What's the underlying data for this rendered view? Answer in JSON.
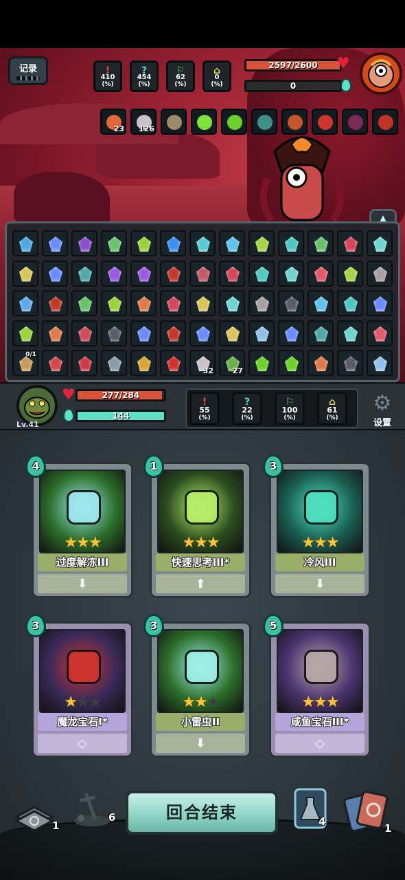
{
  "header": {
    "record_label": "记录"
  },
  "enemy": {
    "stats": [
      {
        "glyph": "!",
        "value": "410",
        "unit": "(%)",
        "color": "#e24a4a"
      },
      {
        "glyph": "?",
        "value": "454",
        "unit": "(%)",
        "color": "#4ad6d0"
      },
      {
        "glyph": "⚐",
        "value": "62",
        "unit": "(%)",
        "color": "#5fdc5a"
      },
      {
        "glyph": "⌂",
        "value": "0",
        "unit": "(%)",
        "color": "#e4d35a"
      }
    ],
    "hp_text": "2597/2600",
    "hp_fraction": 0.999,
    "energy_text": "0",
    "buffs": [
      {
        "icon": "fire-icon",
        "count": "23",
        "color": "#e1683a"
      },
      {
        "icon": "spiral-shell-icon",
        "count": "126",
        "color": "#c9c2c7"
      },
      {
        "icon": "book-icon",
        "count": "",
        "color": "#9a8a6a"
      },
      {
        "icon": "green-gem-icon",
        "count": "",
        "color": "#7ee23c"
      },
      {
        "icon": "green-orb-icon",
        "count": "",
        "color": "#6bd12a"
      },
      {
        "icon": "robot-icon",
        "count": "",
        "color": "#3f8f8a"
      },
      {
        "icon": "dragon-wing-icon",
        "count": "",
        "color": "#c7552a"
      },
      {
        "icon": "tripod-icon",
        "count": "",
        "color": "#d0342f"
      },
      {
        "icon": "claw-icon",
        "count": "",
        "color": "#7a2a55"
      },
      {
        "icon": "bead-ring-icon",
        "count": "",
        "color": "#c23426"
      }
    ]
  },
  "inventory": {
    "rows": [
      [
        {
          "icon": "blue-star-icon",
          "color": "#4fa8e0",
          "count": ""
        },
        {
          "icon": "blue-crystal-icon",
          "color": "#6a8cff",
          "count": ""
        },
        {
          "icon": "purple-gem-icon",
          "color": "#8a4fd0",
          "count": ""
        },
        {
          "icon": "leaf-icon",
          "color": "#6bc06a",
          "count": ""
        },
        {
          "icon": "green-crystal-icon",
          "color": "#9ad23a",
          "count": ""
        },
        {
          "icon": "lightning-icon",
          "color": "#3a8ef0",
          "count": ""
        },
        {
          "icon": "teal-shard-icon",
          "color": "#57c9d6",
          "count": ""
        },
        {
          "icon": "cyan-crystal-icon",
          "color": "#5fc2e8",
          "count": ""
        },
        {
          "icon": "lime-crystal-icon",
          "color": "#a6d445",
          "count": ""
        },
        {
          "icon": "aqua-gem-icon",
          "color": "#4ec7c0",
          "count": ""
        },
        {
          "icon": "leaf-icon",
          "color": "#6bc06a",
          "count": ""
        },
        {
          "icon": "red-gem-icon",
          "color": "#d8455a",
          "count": ""
        },
        {
          "icon": "swirl-icon",
          "color": "#6fd3d0",
          "count": ""
        }
      ],
      [
        {
          "icon": "sun-icon",
          "color": "#d9c45a",
          "count": ""
        },
        {
          "icon": "blue-crystal-icon",
          "color": "#6a8cff",
          "count": ""
        },
        {
          "icon": "teal-blade-icon",
          "color": "#4fa8a8",
          "count": ""
        },
        {
          "icon": "violet-crystal-icon",
          "color": "#9a5ae0",
          "count": ""
        },
        {
          "icon": "violet-crystal-icon",
          "color": "#9a5ae0",
          "count": ""
        },
        {
          "icon": "dragon-gem-icon",
          "color": "#c2392a",
          "count": ""
        },
        {
          "icon": "fish-gem-icon",
          "color": "#c25a6a",
          "count": ""
        },
        {
          "icon": "crimson-gem-icon",
          "color": "#d0485a",
          "count": ""
        },
        {
          "icon": "aqua-gem-icon",
          "color": "#4ec7c0",
          "count": ""
        },
        {
          "icon": "swirl-icon",
          "color": "#6fd3d0",
          "count": ""
        },
        {
          "icon": "ruby-gem-icon",
          "color": "#e05a6a",
          "count": ""
        },
        {
          "icon": "lime-crystal-icon",
          "color": "#a6d445",
          "count": ""
        },
        {
          "icon": "grey-fish-icon",
          "color": "#a8a0a0",
          "count": ""
        }
      ],
      [
        {
          "icon": "hex-gem-icon",
          "color": "#5fa8e8",
          "count": ""
        },
        {
          "icon": "dragon-gem-icon",
          "color": "#c2392a",
          "count": ""
        },
        {
          "icon": "leaf-icon",
          "color": "#6bc06a",
          "count": ""
        },
        {
          "icon": "green-crystal-icon",
          "color": "#9ad23a",
          "count": ""
        },
        {
          "icon": "orange-gem-icon",
          "color": "#e07a4a",
          "count": ""
        },
        {
          "icon": "crimson-gem-icon",
          "color": "#d0485a",
          "count": ""
        },
        {
          "icon": "sun-icon",
          "color": "#d9c45a",
          "count": ""
        },
        {
          "icon": "swirl-icon",
          "color": "#6fd3d0",
          "count": ""
        },
        {
          "icon": "grey-fish-icon",
          "color": "#a8a0a0",
          "count": ""
        },
        {
          "icon": "dark-gem-icon",
          "color": "#5a5a6a",
          "count": ""
        },
        {
          "icon": "cyan-crystal-icon",
          "color": "#5fc2e8",
          "count": ""
        },
        {
          "icon": "aqua-gem-icon",
          "color": "#4ec7c0",
          "count": ""
        },
        {
          "icon": "blue-crystal-icon",
          "color": "#6a8cff",
          "count": ""
        }
      ],
      [
        {
          "icon": "green-crystal-icon",
          "color": "#9ad23a",
          "count": ""
        },
        {
          "icon": "orange-gem-icon",
          "color": "#e07a4a",
          "count": ""
        },
        {
          "icon": "crimson-gem-icon",
          "color": "#d0485a",
          "count": ""
        },
        {
          "icon": "dark-gem-icon",
          "color": "#5a5a6a",
          "count": ""
        },
        {
          "icon": "blue-crystal-icon",
          "color": "#6a8cff",
          "count": ""
        },
        {
          "icon": "dragon-gem-icon",
          "color": "#c2392a",
          "count": ""
        },
        {
          "icon": "blue-crystal-icon",
          "color": "#6a8cff",
          "count": ""
        },
        {
          "icon": "sun-icon",
          "color": "#d9c45a",
          "count": ""
        },
        {
          "icon": "wind-gem-icon",
          "color": "#8fc2e8",
          "count": ""
        },
        {
          "icon": "blue-crystal-icon",
          "color": "#6a8cff",
          "count": ""
        },
        {
          "icon": "teal-blade-icon",
          "color": "#4fa8a8",
          "count": ""
        },
        {
          "icon": "swirl-icon",
          "color": "#6fd3d0",
          "count": ""
        },
        {
          "icon": "ruby-gem-icon",
          "color": "#e05a6a",
          "count": ""
        }
      ],
      [
        {
          "icon": "lightning-bug-icon",
          "color": "#c89a5a",
          "count": "",
          "top_label": "0/1"
        },
        {
          "icon": "meat-icon",
          "color": "#d04a4a",
          "count": ""
        },
        {
          "icon": "potion-icon",
          "color": "#d03a4a",
          "count": ""
        },
        {
          "icon": "dagger-icon",
          "color": "#8a9aa8",
          "count": ""
        },
        {
          "icon": "sword-icon",
          "color": "#d9a43a",
          "count": ""
        },
        {
          "icon": "red-sword-icon",
          "color": "#d0342f",
          "count": ""
        },
        {
          "icon": "spiral-shell-icon",
          "color": "#c9c2c7",
          "count": "32"
        },
        {
          "icon": "green-hand-icon",
          "color": "#6bb04a",
          "count": "27"
        },
        {
          "icon": "green-ring-icon",
          "color": "#6bd12a",
          "count": ""
        },
        {
          "icon": "green-ring-icon",
          "color": "#6bd12a",
          "count": ""
        },
        {
          "icon": "orange-gem-icon",
          "color": "#e07a4a",
          "count": ""
        },
        {
          "icon": "dark-gem-icon",
          "color": "#5a5a6a",
          "count": ""
        },
        {
          "icon": "wind-gem-icon",
          "color": "#8fc2e8",
          "count": ""
        }
      ]
    ]
  },
  "player": {
    "level": "Lv.41",
    "hp_text": "277/284",
    "hp_fraction": 0.975,
    "energy_text": "144",
    "energy_fraction": 1.0,
    "stats": [
      {
        "glyph": "!",
        "value": "55",
        "unit": "(%)",
        "color": "#e24a4a"
      },
      {
        "glyph": "?",
        "value": "22",
        "unit": "(%)",
        "color": "#4ad6d0"
      },
      {
        "glyph": "⚐",
        "value": "100",
        "unit": "(%)",
        "color": "#5fdc5a"
      },
      {
        "glyph": "⌂",
        "value": "61",
        "unit": "(%)",
        "color": "#e4d35a"
      }
    ],
    "settings_label": "设置"
  },
  "hand": {
    "cards": [
      {
        "name": "过度解冻III",
        "cost": "4",
        "stars": 3,
        "max_stars": 3,
        "theme": "green",
        "art": "ice-cube-icon",
        "art_color": "#9fe8f0",
        "bg_color": "#2c6e2a",
        "action": "down"
      },
      {
        "name": "快速思考III*",
        "cost": "1",
        "stars": 3,
        "max_stars": 3,
        "theme": "green",
        "art": "thinking-figure-icon",
        "art_color": "#b8f06a",
        "bg_color": "#2b4d1f",
        "action": "up"
      },
      {
        "name": "冷风III",
        "cost": "3",
        "stars": 3,
        "max_stars": 3,
        "theme": "green",
        "art": "cold-wind-icon",
        "art_color": "#4fe0c0",
        "bg_color": "#1a5f52",
        "action": "down"
      },
      {
        "name": "魔龙宝石I*",
        "cost": "3",
        "stars": 1,
        "max_stars": 3,
        "theme": "purple",
        "art": "dragon-gem-icon",
        "art_color": "#d0342f",
        "bg_color": "#3b2a5a",
        "action": "gem"
      },
      {
        "name": "小雷虫II",
        "cost": "3",
        "stars": 2,
        "max_stars": 3,
        "theme": "green",
        "art": "thunder-bug-icon",
        "art_color": "#9ff0ea",
        "bg_color": "#2c6e2a",
        "action": "down"
      },
      {
        "name": "咸鱼宝石III*",
        "cost": "5",
        "stars": 3,
        "max_stars": 3,
        "theme": "purple",
        "art": "salted-fish-icon",
        "art_color": "#b8a8a8",
        "bg_color": "#4a3470",
        "action": "gem"
      }
    ]
  },
  "footer": {
    "draw_pile_count": "1",
    "grave_count": "6",
    "end_turn_label": "回合结束",
    "potion_count": "4",
    "discard_count": "1"
  },
  "colors": {
    "hp_red": "#d9533a",
    "energy_teal": "#5ee0c8",
    "star_gold": "#f7c43a"
  }
}
